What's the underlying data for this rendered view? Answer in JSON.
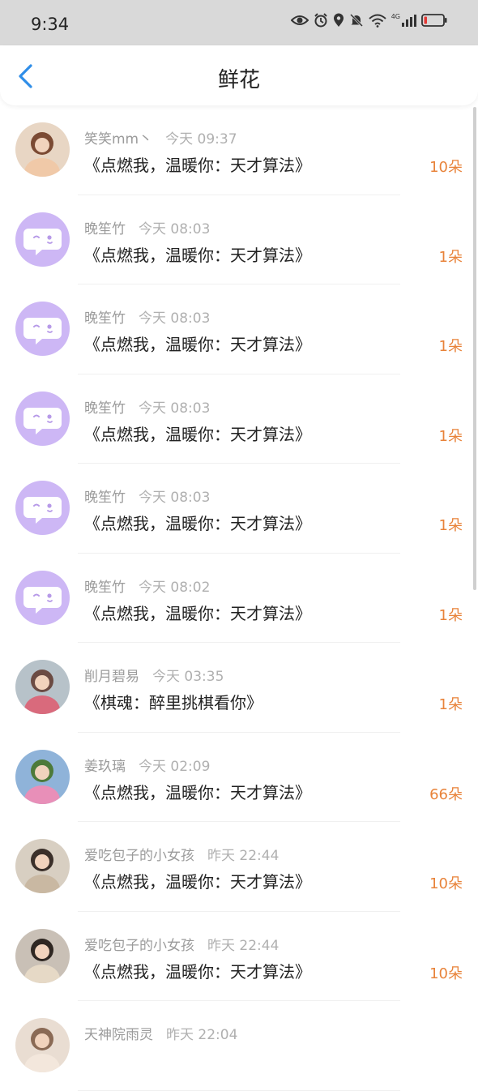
{
  "status": {
    "time": "9:34",
    "network": "4G"
  },
  "header": {
    "title": "鲜花"
  },
  "items": [
    {
      "sender": "笑笑mm丶",
      "time": "今天 09:37",
      "book": "《点燃我，温暖你：天才算法》",
      "count": "10朵",
      "avatar": "photo"
    },
    {
      "sender": "晚笙竹",
      "time": "今天 08:03",
      "book": "《点燃我，温暖你：天才算法》",
      "count": "1朵",
      "avatar": "default"
    },
    {
      "sender": "晚笙竹",
      "time": "今天 08:03",
      "book": "《点燃我，温暖你：天才算法》",
      "count": "1朵",
      "avatar": "default"
    },
    {
      "sender": "晚笙竹",
      "time": "今天 08:03",
      "book": "《点燃我，温暖你：天才算法》",
      "count": "1朵",
      "avatar": "default"
    },
    {
      "sender": "晚笙竹",
      "time": "今天 08:03",
      "book": "《点燃我，温暖你：天才算法》",
      "count": "1朵",
      "avatar": "default"
    },
    {
      "sender": "晚笙竹",
      "time": "今天 08:02",
      "book": "《点燃我，温暖你：天才算法》",
      "count": "1朵",
      "avatar": "default"
    },
    {
      "sender": "削月碧易",
      "time": "今天 03:35",
      "book": "《棋魂：醉里挑棋看你》",
      "count": "1朵",
      "avatar": "photo"
    },
    {
      "sender": "姜玖璃",
      "time": "今天 02:09",
      "book": "《点燃我，温暖你：天才算法》",
      "count": "66朵",
      "avatar": "photo"
    },
    {
      "sender": "爱吃包子的小女孩",
      "time": "昨天 22:44",
      "book": "《点燃我，温暖你：天才算法》",
      "count": "10朵",
      "avatar": "photo"
    },
    {
      "sender": "爱吃包子的小女孩",
      "time": "昨天 22:44",
      "book": "《点燃我，温暖你：天才算法》",
      "count": "10朵",
      "avatar": "photo"
    },
    {
      "sender": "天神院雨灵",
      "time": "昨天 22:04",
      "book": "",
      "count": "",
      "avatar": "photo"
    }
  ],
  "colors": {
    "accent": "#e8833a",
    "back": "#2f8ee8",
    "avatar_default": "#cdb7f5"
  }
}
